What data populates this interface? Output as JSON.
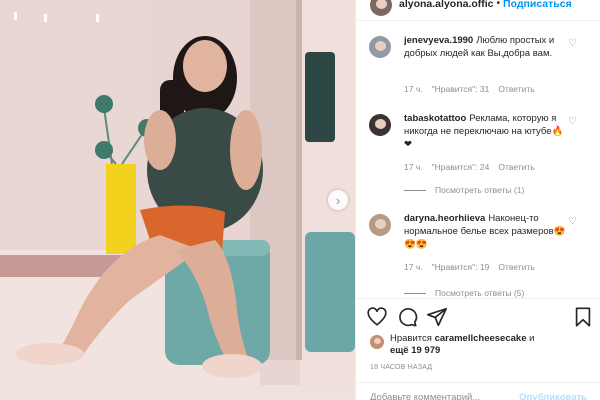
{
  "header": {
    "username": "alyona.alyona.offic",
    "separator": "•",
    "follow_label": "Подписаться"
  },
  "comments": [
    {
      "username": "jenevyeva.1990",
      "text": "Люблю простых и добрых людей как Вы,добра вам.",
      "time": "17 ч.",
      "likes": "\"Нравится\": 31",
      "reply": "Ответить"
    },
    {
      "username": "tabaskotattoo",
      "text": "Реклама, которую я никогда не переключаю на ютубе🔥❤",
      "time": "17 ч.",
      "likes": "\"Нравится\": 24",
      "reply": "Ответить",
      "view_replies": "Посмотреть ответы (1)"
    },
    {
      "username": "daryna.heorhiieva",
      "text": "Наконец-то нормальное белье всех размеров😍😍😍",
      "time": "17 ч.",
      "likes": "\"Нравится\": 19",
      "reply": "Ответить",
      "view_replies": "Посмотреть ответы (5)"
    }
  ],
  "actions": [
    "heart-icon",
    "comment-icon",
    "share-icon",
    "bookmark-icon"
  ],
  "likes": {
    "prefix": "Нравится",
    "user": "caramellcheesecake",
    "suffix": "и",
    "count_line": "ещё 19 979"
  },
  "timestamp": "18 ЧАСОВ НАЗАД",
  "add_comment": {
    "placeholder": "Добавьте комментарий...",
    "publish_label": "Опубликовать"
  },
  "colors": {
    "accent": "#0095f6",
    "wall": "#e9d6d3",
    "top": "#3b4a47",
    "stool": "#6aa7a6",
    "vase": "#f2d21c",
    "shorts": "#d9662d"
  }
}
